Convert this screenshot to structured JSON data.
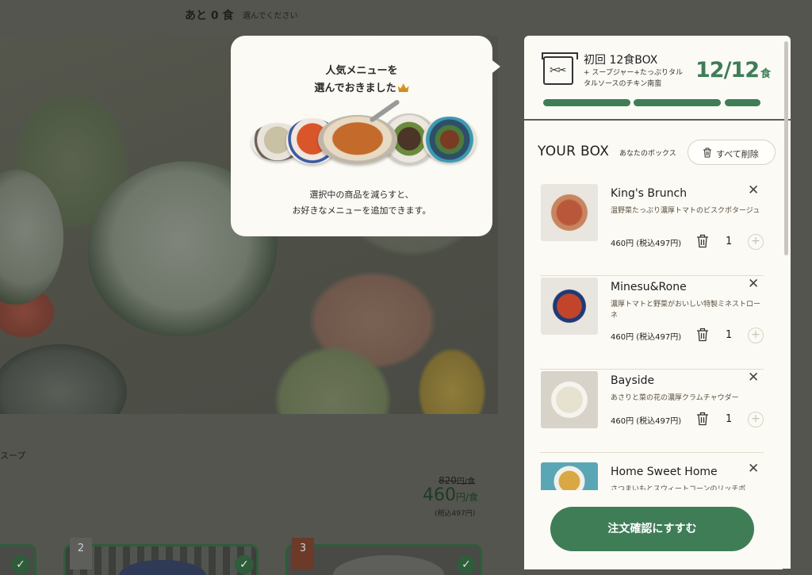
{
  "background": {
    "remaining": "あと 0 食",
    "remaining_hint": "選んでください",
    "soup_label": "スープ",
    "price_old": "820",
    "price_old_unit": "円/食",
    "price_new": "460",
    "price_new_unit": "円/食",
    "price_tax": "(税込497円)",
    "card_numbers": [
      "2",
      "3"
    ]
  },
  "popover": {
    "title_line1": "人気メニューを",
    "title_line2": "選んでおきました",
    "desc_line1": "選択中の商品を減らすと、",
    "desc_line2": "お好きなメニューを追加できます。"
  },
  "box": {
    "title": "初回 12食BOX",
    "subtitle": "+ スープジャー+たっぷりタルタルソースのチキン南蛮",
    "count": "12/12",
    "count_unit": "食",
    "progress_fraction": 1.0,
    "progress_segments": 3
  },
  "your_box": {
    "title": "YOUR BOX",
    "subtitle": "あなたのボックス",
    "clear_all": "すべて削除",
    "items": [
      {
        "name": "King's Brunch",
        "desc": "温野菜たっぷり濃厚トマトのビスクポタージュ",
        "price": "460円 (税込497円)",
        "qty": "1"
      },
      {
        "name": "Minesu&Rone",
        "desc": "濃厚トマトと野菜がおいしい特製ミネストローネ",
        "price": "460円 (税込497円)",
        "qty": "1"
      },
      {
        "name": "Bayside",
        "desc": "あさりと菜の花の濃厚クラムチャウダー",
        "price": "460円 (税込497円)",
        "qty": "1"
      },
      {
        "name": "Home Sweet Home",
        "desc": "さつまいもとスウィートコーンのリッチポ",
        "price": "",
        "qty": ""
      }
    ],
    "cta": "注文確認にすすむ"
  },
  "colors": {
    "accent": "#3f7d57",
    "panel_bg": "#fbfaf5",
    "overlay": "#54554f"
  }
}
